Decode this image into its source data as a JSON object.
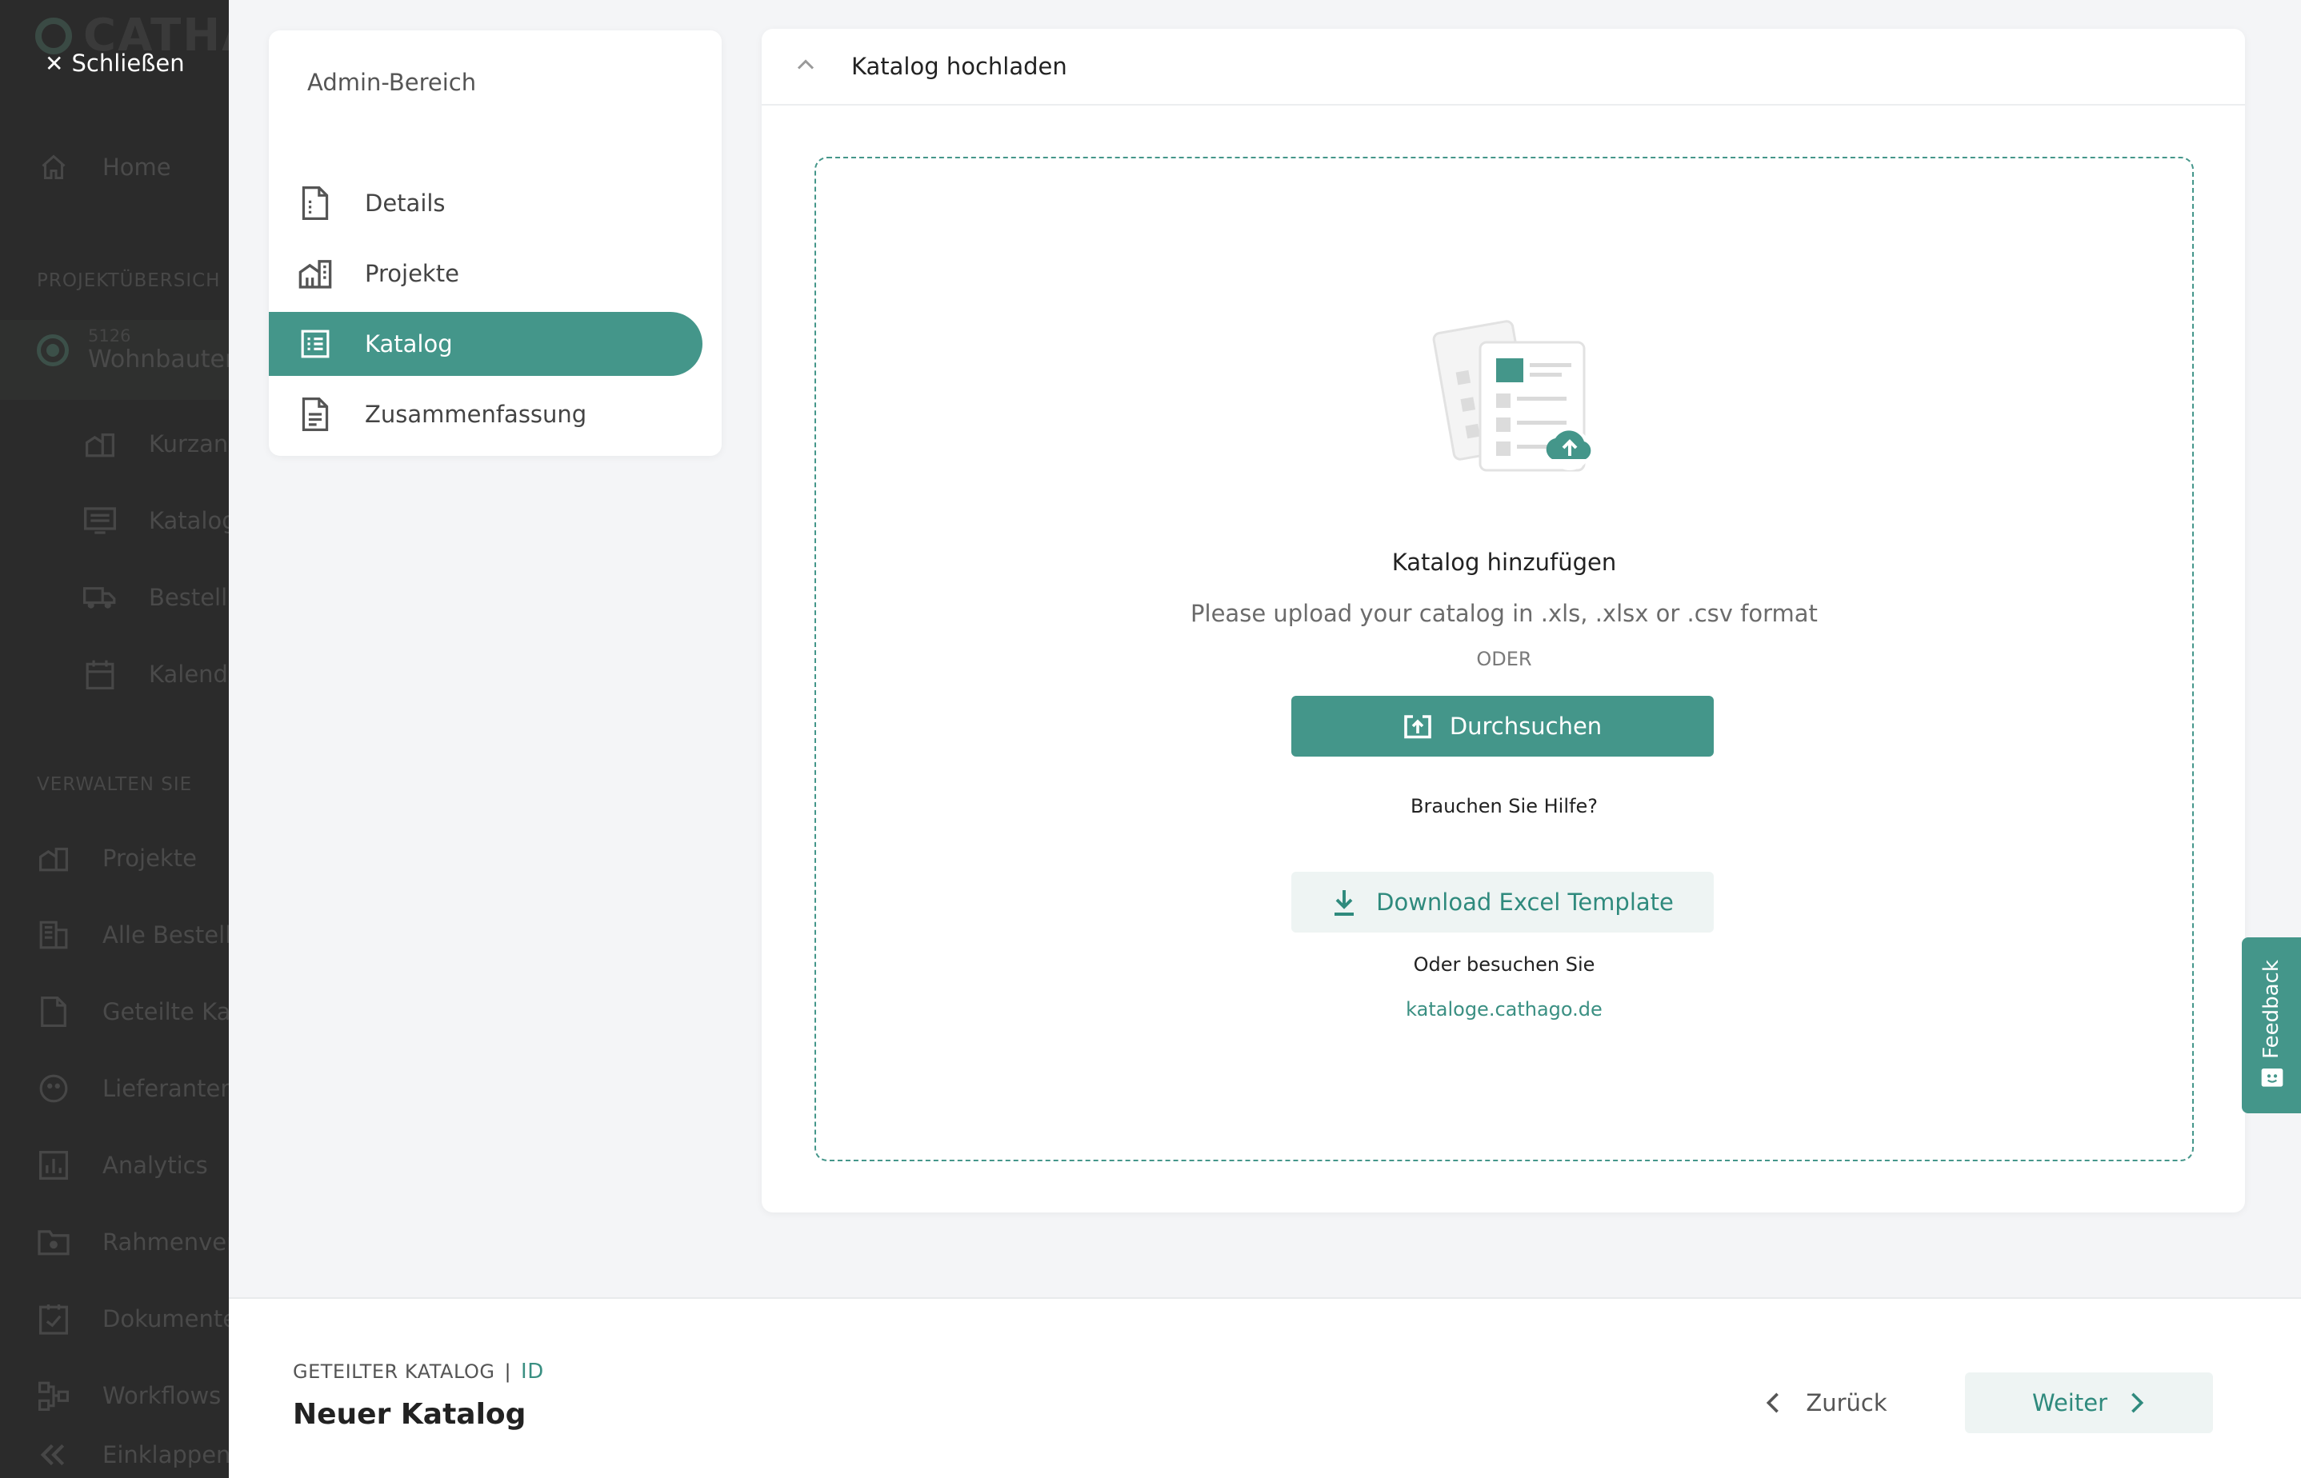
{
  "bg_sidebar": {
    "logo": "CATHA",
    "home": "Home",
    "section_projects": "PROJEKTÜBERSICH",
    "project_number": "5126",
    "project_name": "Wohnbauten",
    "sub_items": [
      "Kurzans",
      "Katalog",
      "Bestell",
      "Kalend"
    ],
    "section_manage": "VERWALTEN SIE",
    "manage_items": [
      "Projekte",
      "Alle Bestell",
      "Geteilte Kat",
      "Lieferanten",
      "Analytics",
      "Rahmenver",
      "Dokumente",
      "Workflows"
    ],
    "collapse": "Einklappen"
  },
  "close_label": "Schließen",
  "admin": {
    "title": "Admin-Bereich",
    "items": [
      {
        "label": "Details",
        "icon": "document-icon"
      },
      {
        "label": "Projekte",
        "icon": "building-icon"
      },
      {
        "label": "Katalog",
        "icon": "catalog-list-icon",
        "active": true
      },
      {
        "label": "Zusammenfassung",
        "icon": "summary-document-icon"
      }
    ]
  },
  "upload": {
    "header_title": "Katalog hochladen",
    "title": "Katalog hinzufügen",
    "description": "Please upload your catalog in .xls, .xlsx or .csv format",
    "or": "ODER",
    "browse_label": "Durchsuchen",
    "help": "Brauchen Sie Hilfe?",
    "download_label": "Download Excel Template",
    "visit": "Oder besuchen Sie",
    "link": "kataloge.cathago.de"
  },
  "feedback_label": "Feedback",
  "footer": {
    "crumb": "GETEILTER KATALOG",
    "separator": "|",
    "id": "ID",
    "name": "Neuer Katalog",
    "back_label": "Zurück",
    "next_label": "Weiter"
  },
  "colors": {
    "accent": "#44968a",
    "accent_light": "#eef4f3",
    "sidebar_bg": "#2b2b2b",
    "page_bg": "#f4f5f7"
  }
}
